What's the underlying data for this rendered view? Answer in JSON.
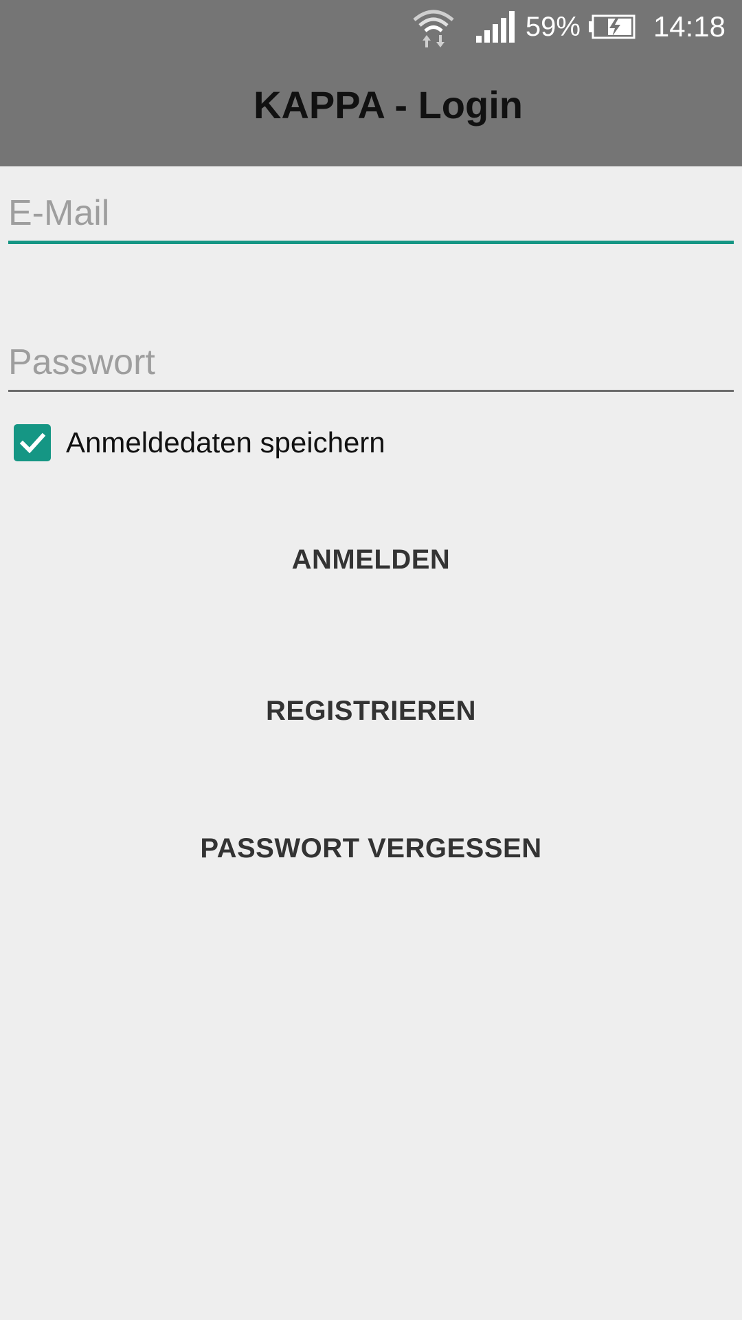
{
  "status_bar": {
    "battery_percent": "59%",
    "time": "14:18",
    "icons": [
      "wifi-icon",
      "signal-icon",
      "battery-charging-icon"
    ]
  },
  "app_bar": {
    "title": "KAPPA - Login",
    "background_color": "#757575"
  },
  "form": {
    "email_placeholder": "E-Mail",
    "email_value": "",
    "password_placeholder": "Passwort",
    "password_value": "",
    "remember_label": "Anmeldedaten speichern",
    "remember_checked": true
  },
  "actions": {
    "login_label": "ANMELDEN",
    "register_label": "REGISTRIEREN",
    "forgot_label": "PASSWORT VERGESSEN"
  },
  "colors": {
    "accent": "#159684",
    "background": "#eeeeee"
  }
}
